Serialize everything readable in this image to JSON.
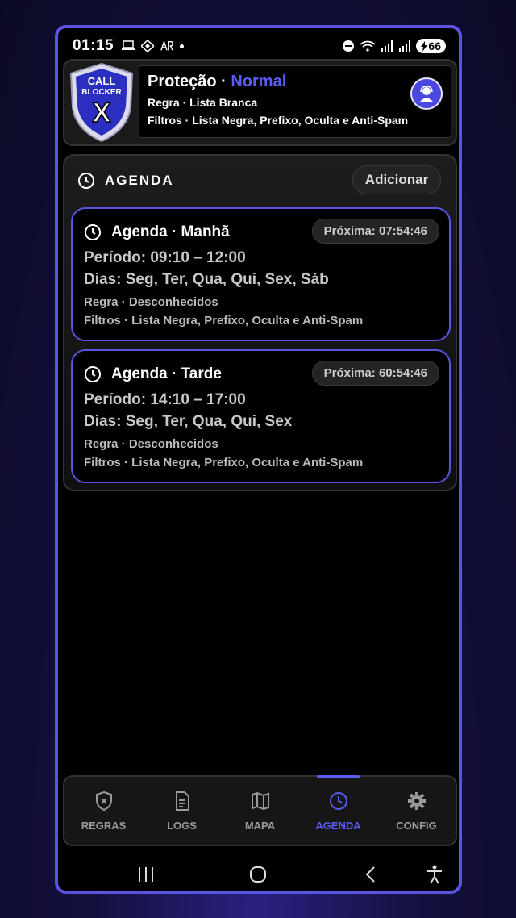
{
  "status_bar": {
    "time": "01:15",
    "battery": "66"
  },
  "header": {
    "logo_text": [
      "CALL",
      "BLOCKER",
      "X"
    ],
    "title_prefix": "Proteção · ",
    "title_status": "Normal",
    "rule": "Regra · Lista Branca",
    "filters": "Filtros · Lista Negra, Prefixo, Oculta e Anti-Spam"
  },
  "agenda": {
    "title": "AGENDA",
    "add_label": "Adicionar",
    "items": [
      {
        "title": "Agenda · Manhã",
        "next": "Próxima: 07:54:46",
        "period": "Período: 09:10 – 12:00",
        "days": "Dias: Seg, Ter, Qua, Qui, Sex, Sáb",
        "rule": "Regra · Desconhecidos",
        "filters": "Filtros · Lista Negra, Prefixo, Oculta e Anti-Spam"
      },
      {
        "title": "Agenda · Tarde",
        "next": "Próxima: 60:54:46",
        "period": "Período: 14:10 – 17:00",
        "days": "Dias: Seg, Ter, Qua, Qui, Sex",
        "rule": "Regra · Desconhecidos",
        "filters": "Filtros · Lista Negra, Prefixo, Oculta e Anti-Spam"
      }
    ]
  },
  "nav": {
    "items": [
      {
        "label": "REGRAS",
        "icon": "shield-x-icon"
      },
      {
        "label": "LOGS",
        "icon": "document-icon"
      },
      {
        "label": "MAPA",
        "icon": "map-icon"
      },
      {
        "label": "AGENDA",
        "icon": "clock-icon"
      },
      {
        "label": "CONFIG",
        "icon": "gear-icon"
      }
    ],
    "active": "AGENDA"
  },
  "colors": {
    "accent": "#5b5cf5",
    "border": "#5a55e0",
    "background": "#000000"
  }
}
